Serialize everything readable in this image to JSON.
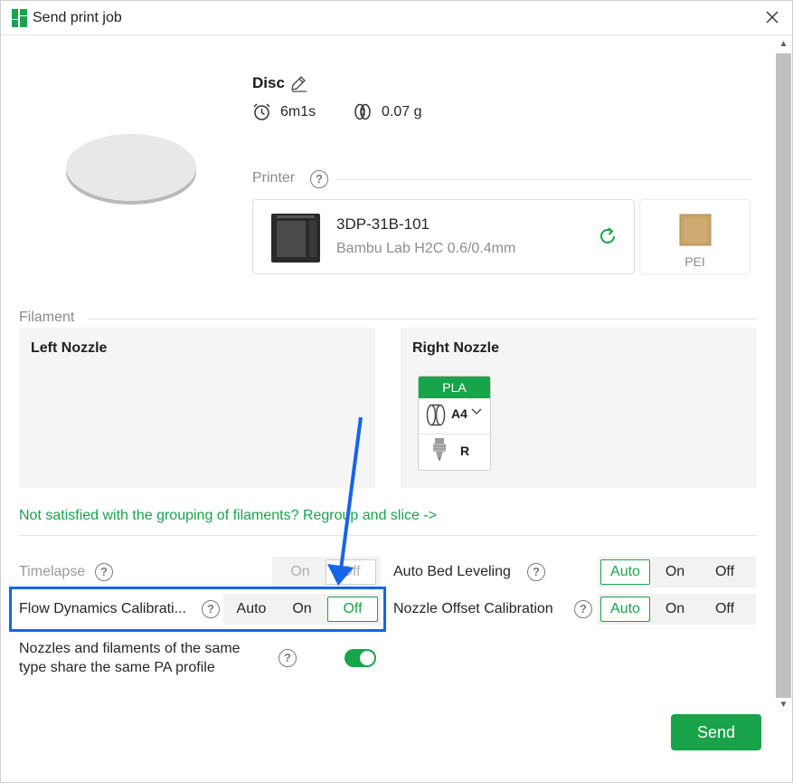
{
  "window": {
    "title": "Send print job"
  },
  "model": {
    "name": "Disc",
    "time": "6m1s",
    "weight": "0.07 g"
  },
  "printer": {
    "section_label": "Printer",
    "name": "3DP-31B-101",
    "model_info": "Bambu Lab H2C  0.6/0.4mm",
    "plate": "PEI"
  },
  "filament": {
    "section_label": "Filament",
    "left_nozzle_title": "Left Nozzle",
    "right_nozzle_title": "Right Nozzle",
    "right_items": [
      {
        "type": "PLA",
        "slot": "A4",
        "side": "R",
        "color": "#19a34a"
      }
    ]
  },
  "regroup_link": "Not satisfied with the grouping of filaments? Regroup and slice ->",
  "options": {
    "timelapse": {
      "label": "Timelapse",
      "choices": [
        "On",
        "Off"
      ],
      "selected": "Off",
      "disabled": true
    },
    "flow_dynamics": {
      "label": "Flow Dynamics Calibrati...",
      "choices": [
        "Auto",
        "On",
        "Off"
      ],
      "selected": "Off"
    },
    "auto_bed_leveling": {
      "label": "Auto Bed Leveling",
      "choices": [
        "Auto",
        "On",
        "Off"
      ],
      "selected": "Auto"
    },
    "nozzle_offset": {
      "label": "Nozzle Offset Calibration",
      "choices": [
        "Auto",
        "On",
        "Off"
      ],
      "selected": "Auto"
    },
    "pa_profile": {
      "label_line1": "Nozzles and filaments of the same",
      "label_line2": "type share the same PA profile",
      "enabled": true
    }
  },
  "send_label": "Send",
  "help_glyph": "?",
  "colors": {
    "accent": "#19a34a",
    "annotation": "#1565e8"
  }
}
